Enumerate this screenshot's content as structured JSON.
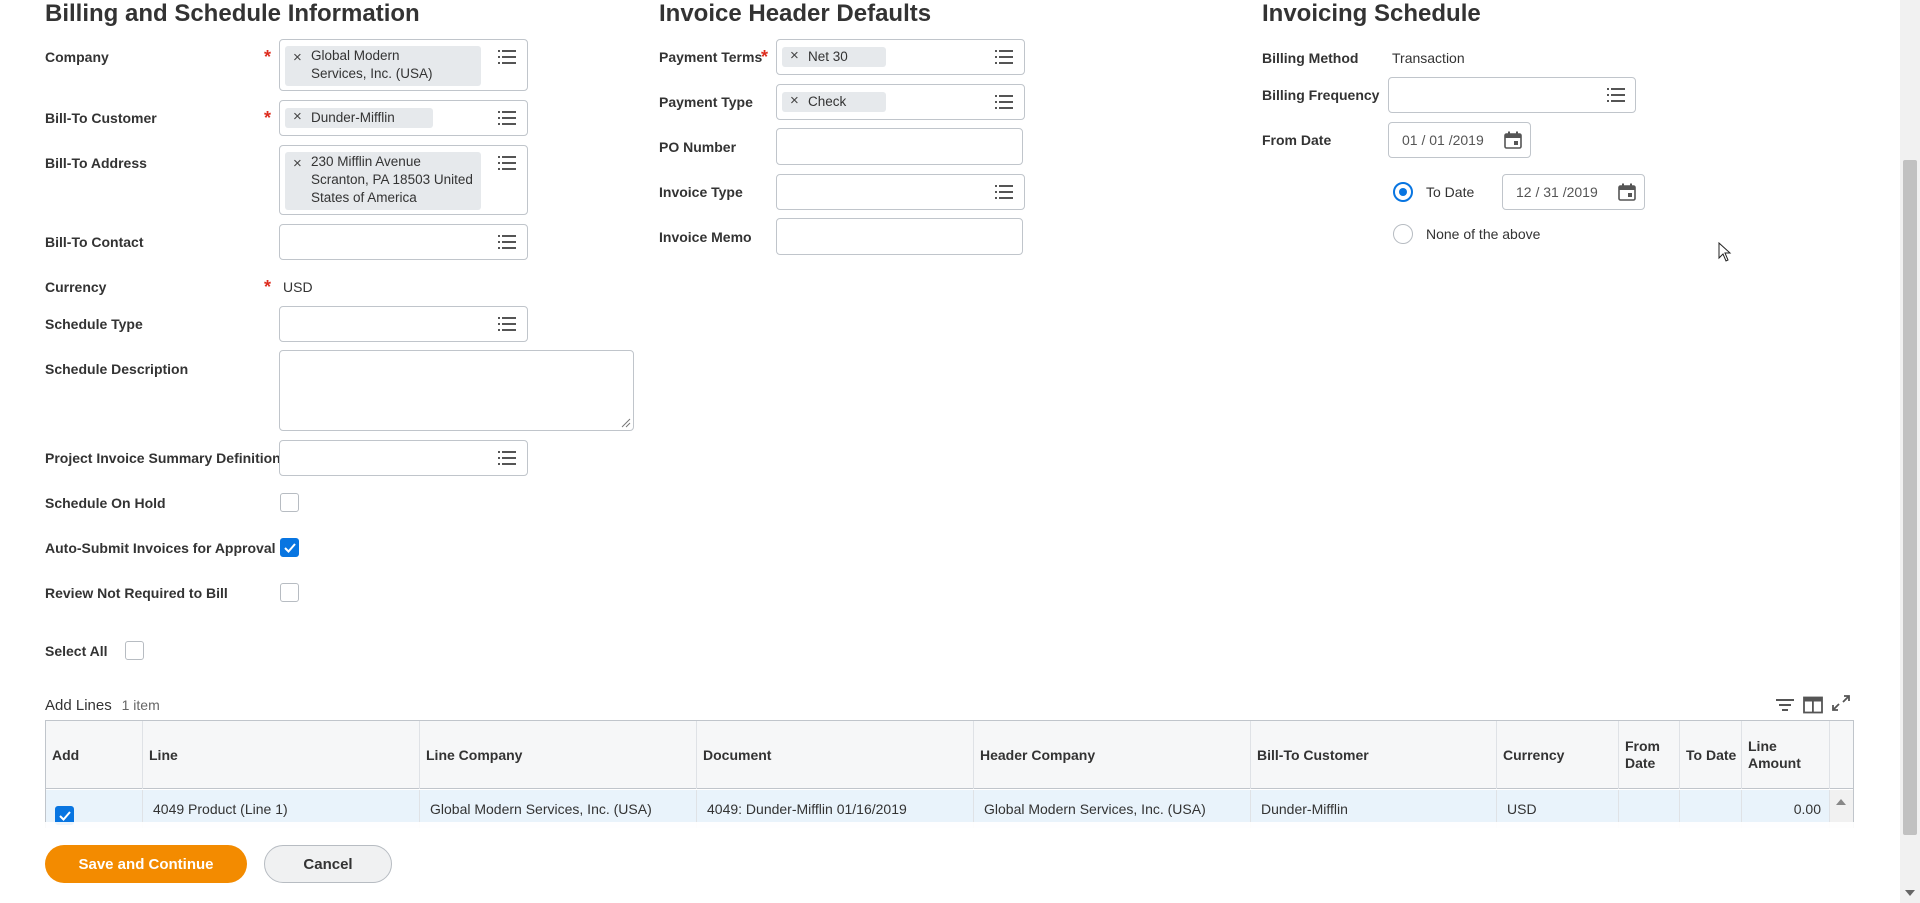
{
  "billing": {
    "title": "Billing and Schedule Information",
    "company": {
      "label": "Company",
      "value": "Global Modern Services, Inc. (USA)",
      "line1": "Global Modern",
      "line2": "Services, Inc. (USA)"
    },
    "bill_to_customer": {
      "label": "Bill-To Customer",
      "value": "Dunder-Mifflin"
    },
    "bill_to_address": {
      "label": "Bill-To Address",
      "line1": "230 Mifflin Avenue",
      "line2": "Scranton, PA 18503 United",
      "line3": "States of America"
    },
    "bill_to_contact": {
      "label": "Bill-To Contact",
      "value": ""
    },
    "currency": {
      "label": "Currency",
      "value": "USD"
    },
    "schedule_type": {
      "label": "Schedule Type",
      "value": ""
    },
    "schedule_description": {
      "label": "Schedule Description",
      "value": ""
    },
    "project_invoice_summary": {
      "label": "Project Invoice Summary Definition",
      "value": ""
    },
    "schedule_on_hold": {
      "label": "Schedule On Hold",
      "checked": false
    },
    "auto_submit": {
      "label": "Auto-Submit Invoices for Approval",
      "checked": true
    },
    "review_not_required": {
      "label": "Review Not Required to Bill",
      "checked": false
    },
    "select_all": {
      "label": "Select All",
      "checked": false
    }
  },
  "invoice_header": {
    "title": "Invoice Header Defaults",
    "payment_terms": {
      "label": "Payment Terms",
      "value": "Net 30"
    },
    "payment_type": {
      "label": "Payment Type",
      "value": "Check"
    },
    "po_number": {
      "label": "PO Number",
      "value": ""
    },
    "invoice_type": {
      "label": "Invoice Type",
      "value": ""
    },
    "invoice_memo": {
      "label": "Invoice Memo",
      "value": ""
    }
  },
  "invoicing_schedule": {
    "title": "Invoicing Schedule",
    "billing_method": {
      "label": "Billing Method",
      "value": "Transaction"
    },
    "billing_frequency": {
      "label": "Billing Frequency",
      "value": ""
    },
    "from_date": {
      "label": "From Date",
      "month": "01",
      "day": "01",
      "year": "2019"
    },
    "to_date": {
      "label": "To Date",
      "selected": true,
      "month": "12",
      "day": "31",
      "year": "2019"
    },
    "none_of_above": {
      "label": "None of the above",
      "selected": false
    }
  },
  "add_lines": {
    "title": "Add Lines",
    "count": "1 item",
    "columns": [
      "Add",
      "Line",
      "Line Company",
      "Document",
      "Header Company",
      "Bill-To Customer",
      "Currency",
      "From Date",
      "To Date",
      "Line Amount"
    ],
    "rows": [
      {
        "checked": true,
        "line": "4049 Product (Line 1)",
        "line_company": "Global Modern Services, Inc. (USA)",
        "document": "4049: Dunder-Mifflin 01/16/2019",
        "header_company": "Global Modern Services, Inc. (USA)",
        "bill_to_customer": "Dunder-Mifflin",
        "currency": "USD",
        "from_date": "",
        "to_date": "",
        "line_amount": "0.00"
      }
    ]
  },
  "footer": {
    "save_label": "Save and Continue",
    "cancel_label": "Cancel"
  },
  "colors": {
    "accent": "#0875e1",
    "primary_button": "#f38b00",
    "required": "#de2d1f"
  }
}
